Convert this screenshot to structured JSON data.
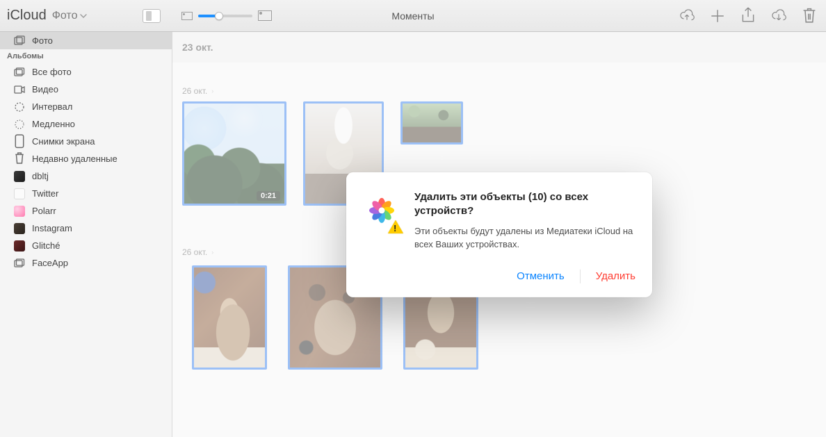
{
  "toolbar": {
    "app": "iCloud",
    "subtitle": "Фото",
    "view_title": "Моменты"
  },
  "sidebar": {
    "primary": {
      "label": "Фото"
    },
    "section_label": "Альбомы",
    "items": [
      {
        "label": "Все фото"
      },
      {
        "label": "Видео"
      },
      {
        "label": "Интервал"
      },
      {
        "label": "Медленно"
      },
      {
        "label": "Снимки экрана"
      },
      {
        "label": "Недавно удаленные"
      },
      {
        "label": "dbltj"
      },
      {
        "label": "Twitter"
      },
      {
        "label": "Polarr"
      },
      {
        "label": "Instagram"
      },
      {
        "label": "Glitché"
      },
      {
        "label": "FaceApp"
      }
    ]
  },
  "content": {
    "header_date": "23 окт.",
    "groups": [
      {
        "title": "26 окт.",
        "video_duration": "0:21"
      },
      {
        "title": "26 окт."
      }
    ]
  },
  "modal": {
    "title": "Удалить эти объекты (10) со всех устройств?",
    "message": "Эти объекты будут удалены из Медиатеки iCloud на всех Ваших устройствах.",
    "cancel": "Отменить",
    "confirm": "Удалить"
  }
}
